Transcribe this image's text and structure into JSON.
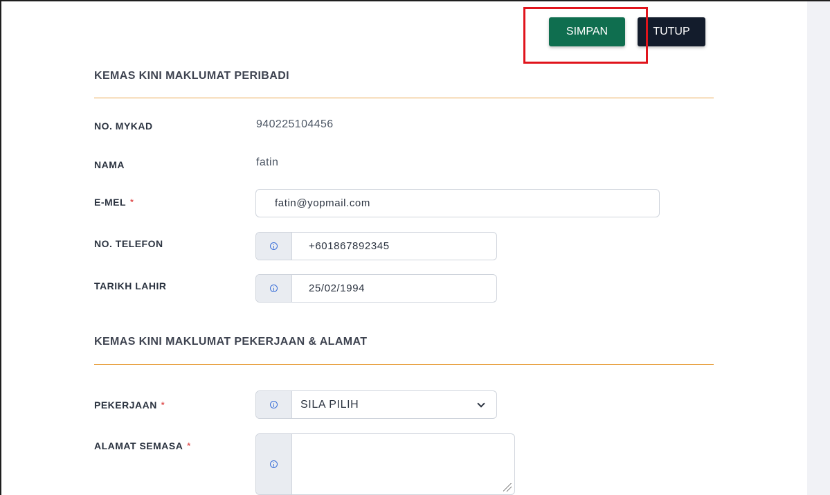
{
  "toolbar": {
    "save_label": "SIMPAN",
    "close_label": "TUTUP"
  },
  "sections": {
    "personal_title": "KEMAS KINI MAKLUMAT PERIBADI",
    "job_address_title": "KEMAS KINI MAKLUMAT PEKERJAAN & ALAMAT"
  },
  "fields": {
    "mykad": {
      "label": "NO. MYKAD",
      "value": "940225104456"
    },
    "nama": {
      "label": "NAMA",
      "value": "fatin"
    },
    "emel": {
      "label": "E-MEL",
      "required_mark": "*",
      "value": "fatin@yopmail.com"
    },
    "telefon": {
      "label": "NO. TELEFON",
      "value": "+601867892345",
      "icon": "info-icon"
    },
    "tarikh_lahir": {
      "label": "TARIKH LAHIR",
      "value": "25/02/1994",
      "icon": "info-icon"
    },
    "pekerjaan": {
      "label": "PEKERJAAN",
      "required_mark": "*",
      "selected": "SILA PILIH",
      "icon": "info-icon"
    },
    "alamat": {
      "label": "ALAMAT SEMASA",
      "required_mark": "*",
      "value": "",
      "icon": "info-icon"
    }
  },
  "colors": {
    "save_button": "#0f6e4f",
    "close_button": "#131c2c",
    "highlight": "#e0141c",
    "divider": "#e9a64b",
    "required": "#e05252",
    "info_icon": "#3a6fd8"
  }
}
